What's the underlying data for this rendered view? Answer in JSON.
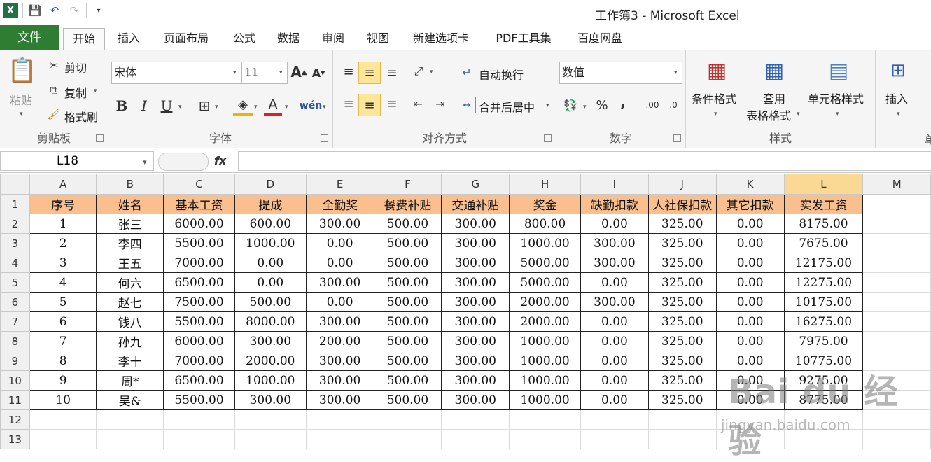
{
  "window": {
    "title": "工作簿3 - Microsoft Excel"
  },
  "tabs": [
    "文件",
    "开始",
    "插入",
    "页面布局",
    "公式",
    "数据",
    "审阅",
    "视图",
    "新建选项卡",
    "PDF工具集",
    "百度网盘"
  ],
  "ribbon": {
    "clipboard": {
      "group": "剪贴板",
      "paste": "粘贴",
      "cut": "剪切",
      "copy": "复制",
      "painter": "格式刷"
    },
    "font": {
      "group": "字体",
      "name": "宋体",
      "size": "11",
      "bold": "B",
      "italic": "I",
      "underline": "U"
    },
    "alignment": {
      "group": "对齐方式",
      "wrap": "自动换行",
      "merge": "合并后居中"
    },
    "number": {
      "group": "数字",
      "format": "数值",
      "percent": "%",
      "comma": ","
    },
    "styles": {
      "group": "样式",
      "conditional": "条件格式",
      "table1": "套用",
      "table2": "表格格式",
      "cell": "单元格样式"
    },
    "cells": {
      "insert": "插入",
      "group": "单"
    }
  },
  "formula_bar": {
    "name_box": "L18",
    "fx": "fx",
    "value": ""
  },
  "columns": [
    "A",
    "B",
    "C",
    "D",
    "E",
    "F",
    "G",
    "H",
    "I",
    "J",
    "K",
    "L",
    "M"
  ],
  "rows": [
    "1",
    "2",
    "3",
    "4",
    "5",
    "6",
    "7",
    "8",
    "9",
    "10",
    "11",
    "12",
    "13"
  ],
  "active_column": "L",
  "sheet": {
    "header": [
      "序号",
      "姓名",
      "基本工资",
      "提成",
      "全勤奖",
      "餐费补贴",
      "交通补贴",
      "奖金",
      "缺勤扣款",
      "人社保扣款",
      "其它扣款",
      "实发工资"
    ],
    "data": [
      [
        "1",
        "张三",
        "6000.00",
        "600.00",
        "300.00",
        "500.00",
        "300.00",
        "800.00",
        "0.00",
        "325.00",
        "0.00",
        "8175.00"
      ],
      [
        "2",
        "李四",
        "5500.00",
        "1000.00",
        "0.00",
        "500.00",
        "300.00",
        "1000.00",
        "300.00",
        "325.00",
        "0.00",
        "7675.00"
      ],
      [
        "3",
        "王五",
        "7000.00",
        "0.00",
        "0.00",
        "500.00",
        "300.00",
        "5000.00",
        "300.00",
        "325.00",
        "0.00",
        "12175.00"
      ],
      [
        "4",
        "何六",
        "6500.00",
        "0.00",
        "300.00",
        "500.00",
        "300.00",
        "5000.00",
        "0.00",
        "325.00",
        "0.00",
        "12275.00"
      ],
      [
        "5",
        "赵七",
        "7500.00",
        "500.00",
        "0.00",
        "500.00",
        "300.00",
        "2000.00",
        "300.00",
        "325.00",
        "0.00",
        "10175.00"
      ],
      [
        "6",
        "钱八",
        "5500.00",
        "8000.00",
        "300.00",
        "500.00",
        "300.00",
        "2000.00",
        "0.00",
        "325.00",
        "0.00",
        "16275.00"
      ],
      [
        "7",
        "孙九",
        "6000.00",
        "300.00",
        "200.00",
        "500.00",
        "300.00",
        "1000.00",
        "0.00",
        "325.00",
        "0.00",
        "7975.00"
      ],
      [
        "8",
        "李十",
        "7000.00",
        "2000.00",
        "300.00",
        "500.00",
        "300.00",
        "1000.00",
        "0.00",
        "325.00",
        "0.00",
        "10775.00"
      ],
      [
        "9",
        "周*",
        "6500.00",
        "1000.00",
        "300.00",
        "500.00",
        "300.00",
        "1000.00",
        "0.00",
        "325.00",
        "0.00",
        "9275.00"
      ],
      [
        "10",
        "吴&",
        "5500.00",
        "300.00",
        "300.00",
        "500.00",
        "300.00",
        "1000.00",
        "0.00",
        "325.00",
        "0.00",
        "8775.00"
      ]
    ]
  },
  "watermark": {
    "main": "Bai du 经验",
    "sub": "jingyan.baidu.com"
  },
  "colors": {
    "header_fill": "#f9bf8f",
    "active_header": "#f9d993",
    "file_tab": "#2e7d32"
  }
}
